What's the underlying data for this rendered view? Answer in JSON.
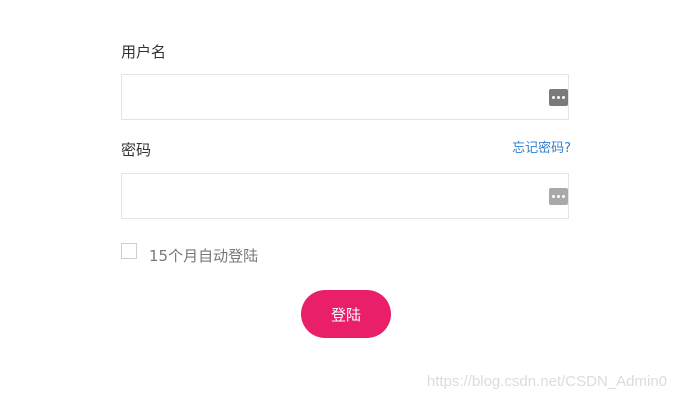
{
  "form": {
    "username_label": "用户名",
    "username_value": "",
    "password_label": "密码",
    "password_value": "",
    "forgot_link": "忘记密码?",
    "remember_label": "15个月自动登陆",
    "remember_checked": false,
    "login_button": "登陆"
  },
  "icons": {
    "username_field_icon": "more-dots-icon",
    "password_field_icon": "more-dots-icon"
  },
  "colors": {
    "primary_button": "#ea1f6a",
    "link": "#2f7fd1"
  },
  "watermark": "https://blog.csdn.net/CSDN_Admin0"
}
